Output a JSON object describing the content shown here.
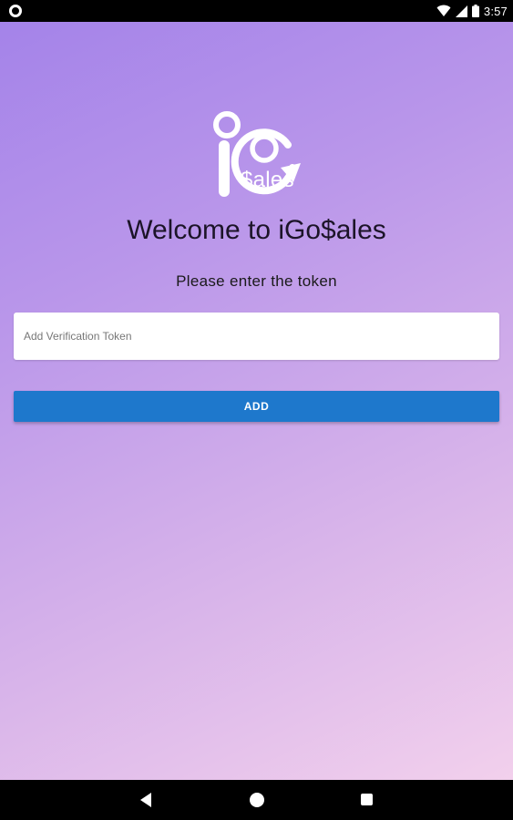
{
  "status_bar": {
    "left_icon": "circle-notification-icon",
    "icons": [
      "wifi-icon",
      "cell-signal-icon",
      "battery-icon"
    ],
    "time": "3:57"
  },
  "app": {
    "logo": {
      "icon": "igosales-logo-icon",
      "text": "$ales"
    },
    "welcome_text": "Welcome to iGo$ales",
    "subtitle": "Please enter the token",
    "token_input": {
      "placeholder": "Add Verification Token",
      "value": ""
    },
    "add_button_label": "ADD",
    "colors": {
      "gradient_start": "#a483e9",
      "gradient_end": "#f2d0ec",
      "button": "#1e78cc"
    }
  },
  "nav_bar": {
    "icons": [
      "back-icon",
      "home-icon",
      "recent-apps-icon"
    ]
  }
}
